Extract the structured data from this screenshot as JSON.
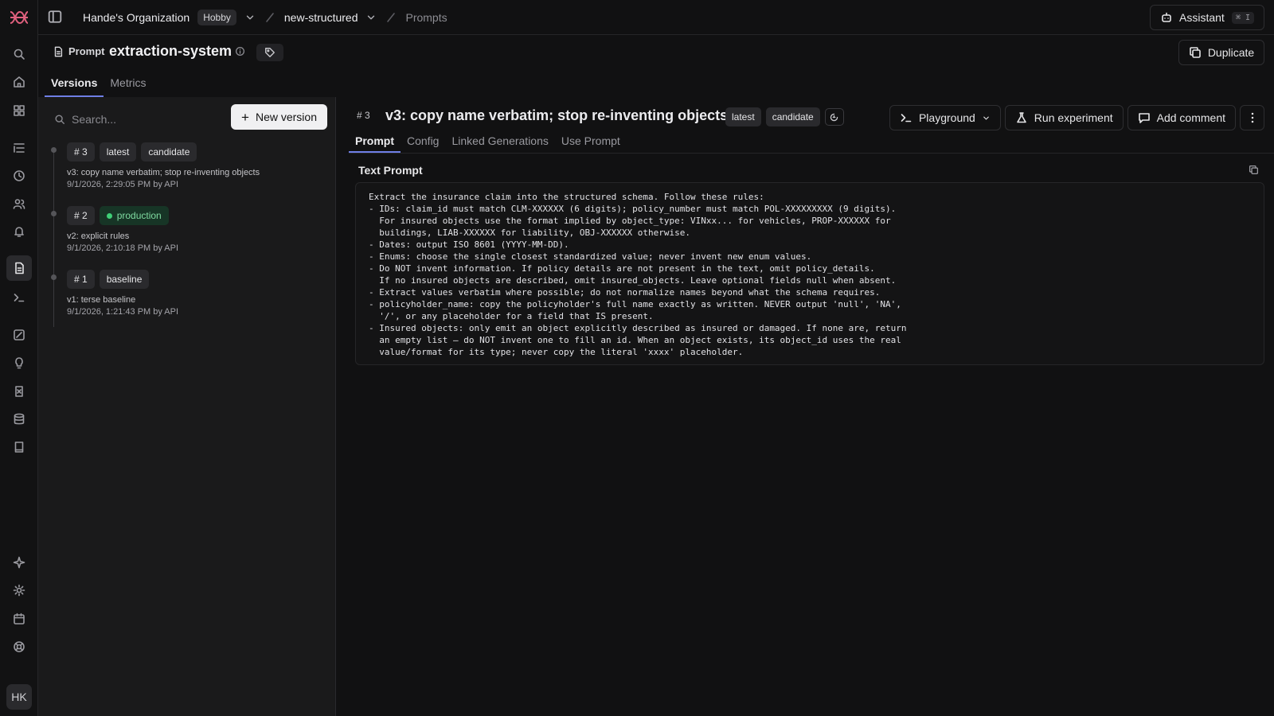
{
  "topbar": {
    "org": "Hande's Organization",
    "plan": "Hobby",
    "project": "new-structured",
    "page": "Prompts",
    "assistant_label": "Assistant",
    "assistant_shortcut": "⌘ I"
  },
  "prompt_header": {
    "type_label": "Prompt",
    "name": "extraction-system",
    "duplicate_label": "Duplicate",
    "tabs": [
      "Versions",
      "Metrics"
    ],
    "active_tab": "Versions"
  },
  "versions_panel": {
    "search_placeholder": "Search...",
    "new_version_label": "New version",
    "items": [
      {
        "num": "# 3",
        "labels": [
          "latest",
          "candidate"
        ],
        "message": "v3: copy name verbatim; stop re-inventing objects",
        "meta": "9/1/2026, 2:29:05 PM by API"
      },
      {
        "num": "# 2",
        "labels": [
          "production"
        ],
        "message": "v2: explicit rules",
        "meta": "9/1/2026, 2:10:18 PM by API"
      },
      {
        "num": "# 1",
        "labels": [
          "baseline"
        ],
        "message": "v1: terse baseline",
        "meta": "9/1/2026, 1:21:43 PM by API"
      }
    ]
  },
  "main": {
    "version_num": "# 3",
    "title": "v3: copy name verbatim; stop re-inventing objects",
    "badges": [
      "latest",
      "candidate"
    ],
    "actions": {
      "playground": "Playground",
      "run_experiment": "Run experiment",
      "add_comment": "Add comment"
    },
    "tabs": [
      "Prompt",
      "Config",
      "Linked Generations",
      "Use Prompt"
    ],
    "active_tab": "Prompt",
    "text_prompt_label": "Text Prompt",
    "prompt_text": "Extract the insurance claim into the structured schema. Follow these rules:\n- IDs: claim_id must match CLM-XXXXXX (6 digits); policy_number must match POL-XXXXXXXXX (9 digits).\n  For insured objects use the format implied by object_type: VINxx... for vehicles, PROP-XXXXXX for\n  buildings, LIAB-XXXXXX for liability, OBJ-XXXXXX otherwise.\n- Dates: output ISO 8601 (YYYY-MM-DD).\n- Enums: choose the single closest standardized value; never invent new enum values.\n- Do NOT invent information. If policy details are not present in the text, omit policy_details.\n  If no insured objects are described, omit insured_objects. Leave optional fields null when absent.\n- Extract values verbatim where possible; do not normalize names beyond what the schema requires.\n- policyholder_name: copy the policyholder's full name exactly as written. NEVER output 'null', 'NA',\n  '/', or any placeholder for a field that IS present.\n- Insured objects: only emit an object explicitly described as insured or damaged. If none are, return\n  an empty list — do NOT invent one to fill an id. When an object exists, its object_id uses the real\n  value/format for its type; never copy the literal 'xxxx' placeholder."
  },
  "user": {
    "initials": "HK"
  },
  "colors": {
    "accent": "#6f7fe6",
    "brand": "#e0607e",
    "production": "#3fcf77"
  }
}
